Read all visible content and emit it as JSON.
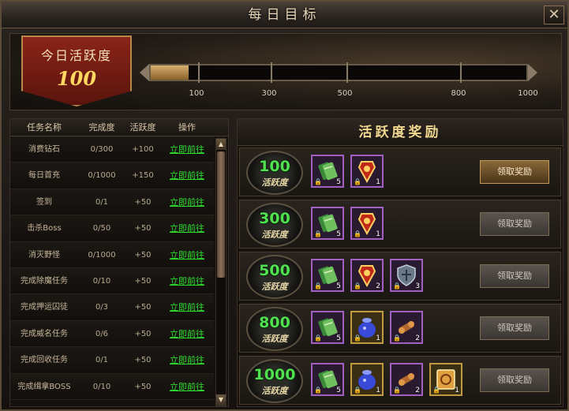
{
  "window": {
    "title": "每日目标",
    "close_label": "✕"
  },
  "activity": {
    "label": "今日活跃度",
    "value": "100",
    "progress": 0.1,
    "max": 1000
  },
  "milestones": [
    "100",
    "300",
    "500",
    "800",
    "1000"
  ],
  "table": {
    "headers": [
      "任务名称",
      "完成度",
      "活跃度",
      "操作"
    ],
    "rows": [
      {
        "name": "消费钻石",
        "progress": "0/300",
        "points": "+100",
        "action": "立即前往"
      },
      {
        "name": "每日首充",
        "progress": "0/1000",
        "points": "+150",
        "action": "立即前往"
      },
      {
        "name": "签到",
        "progress": "0/1",
        "points": "+50",
        "action": "立即前往"
      },
      {
        "name": "击杀Boss",
        "progress": "0/50",
        "points": "+50",
        "action": "立即前往"
      },
      {
        "name": "消灭野怪",
        "progress": "0/1000",
        "points": "+50",
        "action": "立即前往"
      },
      {
        "name": "完成除魔任务",
        "progress": "0/10",
        "points": "+50",
        "action": "立即前往"
      },
      {
        "name": "完成押运囚徒",
        "progress": "0/3",
        "points": "+50",
        "action": "立即前往"
      },
      {
        "name": "完成威名任务",
        "progress": "0/6",
        "points": "+50",
        "action": "立即前往"
      },
      {
        "name": "完成回收任务",
        "progress": "0/1",
        "points": "+50",
        "action": "立即前往"
      },
      {
        "name": "完成缉拿BOSS",
        "progress": "0/10",
        "points": "+50",
        "action": "立即前往"
      }
    ]
  },
  "rewards": {
    "title": "活跃度奖励",
    "tier_word": "活跃度",
    "tiers": [
      {
        "points": "100",
        "button": "领取奖励",
        "active": true,
        "items": [
          {
            "icon": "green-scroll-icon",
            "count": "5",
            "frame": "purple"
          },
          {
            "icon": "red-token-icon",
            "count": "1",
            "frame": "purple"
          }
        ]
      },
      {
        "points": "300",
        "button": "领取奖励",
        "active": false,
        "items": [
          {
            "icon": "green-scroll-icon",
            "count": "5",
            "frame": "purple"
          },
          {
            "icon": "red-token-icon",
            "count": "1",
            "frame": "purple"
          }
        ]
      },
      {
        "points": "500",
        "button": "领取奖励",
        "active": false,
        "items": [
          {
            "icon": "green-scroll-icon",
            "count": "5",
            "frame": "purple"
          },
          {
            "icon": "red-token-icon",
            "count": "2",
            "frame": "purple"
          },
          {
            "icon": "shield-icon",
            "count": "3",
            "frame": "purple"
          }
        ]
      },
      {
        "points": "800",
        "button": "领取奖励",
        "active": false,
        "items": [
          {
            "icon": "green-scroll-icon",
            "count": "5",
            "frame": "purple"
          },
          {
            "icon": "blue-pouch-icon",
            "count": "1",
            "frame": "gold"
          },
          {
            "icon": "bronze-scroll-icon",
            "count": "2",
            "frame": "purple"
          }
        ]
      },
      {
        "points": "1000",
        "button": "领取奖励",
        "active": false,
        "items": [
          {
            "icon": "green-scroll-icon",
            "count": "5",
            "frame": "purple"
          },
          {
            "icon": "blue-pouch-icon",
            "count": "1",
            "frame": "gold"
          },
          {
            "icon": "bronze-scroll-icon",
            "count": "2",
            "frame": "purple"
          },
          {
            "icon": "gold-book-icon",
            "count": "1",
            "frame": "gold"
          }
        ]
      }
    ]
  },
  "colors": {
    "accent_green": "#30e030",
    "medal_green": "#50e050",
    "gold": "#ffd860",
    "purple_frame": "#a060c0"
  }
}
